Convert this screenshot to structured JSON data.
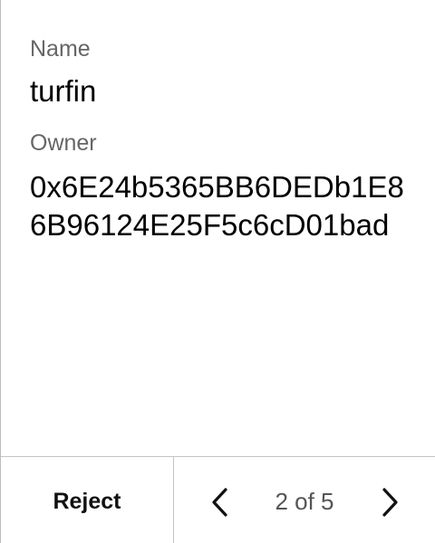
{
  "details": {
    "name_label": "Name",
    "name_value": "turfin",
    "owner_label": "Owner",
    "owner_value": "0x6E24b5365BB6DEDb1E86B96124E25F5c6cD01bad"
  },
  "footer": {
    "reject_label": "Reject",
    "page_indicator": "2 of 5",
    "current_page": 2,
    "total_pages": 5,
    "prev_icon": "chevron-left-icon",
    "next_icon": "chevron-right-icon"
  }
}
